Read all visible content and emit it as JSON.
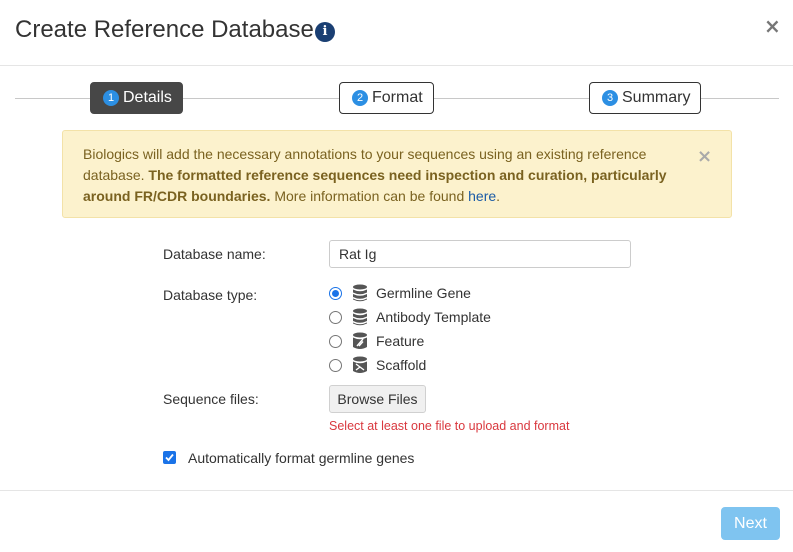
{
  "dialog": {
    "title": "Create Reference Database",
    "info_glyph": "i",
    "close_glyph": "×"
  },
  "steps": [
    {
      "num": "1",
      "label": "Details",
      "active": true
    },
    {
      "num": "2",
      "label": "Format",
      "active": false
    },
    {
      "num": "3",
      "label": "Summary",
      "active": false
    }
  ],
  "alert": {
    "text_start": "Biologics will add the necessary annotations to your sequences using an existing reference database. ",
    "text_bold": "The formatted reference sequences need inspection and curation, particularly around FR/CDR boundaries.",
    "text_end": " More information can be found ",
    "link_text": "here",
    "text_tail": ".",
    "close_glyph": "×"
  },
  "form": {
    "name_label": "Database name:",
    "name_value": "Rat Ig",
    "type_label": "Database type:",
    "types": [
      {
        "label": "Germline Gene",
        "icon": "database-icon",
        "checked": true
      },
      {
        "label": "Antibody Template",
        "icon": "database-icon",
        "checked": false
      },
      {
        "label": "Feature",
        "icon": "database-feature-icon",
        "checked": false
      },
      {
        "label": "Scaffold",
        "icon": "database-scaffold-icon",
        "checked": false
      }
    ],
    "files_label": "Sequence files:",
    "browse_label": "Browse Files",
    "error_text": "Select at least one file to upload and format",
    "auto_format_label": "Automatically format germline genes",
    "auto_format_checked": true
  },
  "footer": {
    "next_label": "Next"
  },
  "colors": {
    "accent": "#1a73e8",
    "step_number": "#2c8fe3",
    "alert_bg": "#fcf2cd",
    "error": "#d9383e",
    "next_disabled": "#7fc4f0"
  }
}
